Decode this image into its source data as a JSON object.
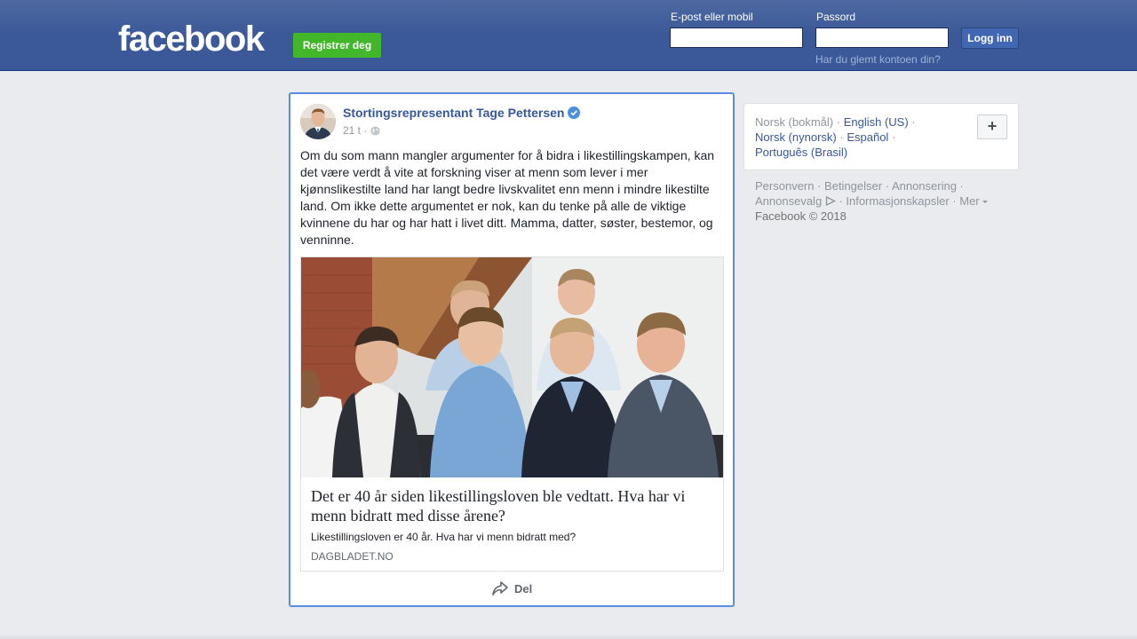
{
  "header": {
    "logo_text": "facebook",
    "register_label": "Registrer deg",
    "email_label": "E-post eller mobil",
    "email_value": "",
    "password_label": "Passord",
    "password_value": "",
    "login_label": "Logg inn",
    "forgot_link": "Har du glemt kontoen din?"
  },
  "post": {
    "author": "Stortingsrepresentant Tage Pettersen",
    "time": "21 t ·",
    "text": "Om du som mann mangler argumenter for å bidra i likestillingskampen, kan det være verdt å vite at forskning viser at menn som lever i mer kjønnslikestilte land har langt bedre livskvalitet enn menn i mindre likestilte land. Om ikke dette argumentet er nok, kan du tenke på alle de viktige kvinnene du har og har hatt i livet ditt. Mamma, datter, søster, bestemor, og venninne.",
    "link": {
      "title": "Det er 40 år siden likestillingsloven ble vedtatt. Hva har vi menn bidratt med disse årene?",
      "description": "Likestillingsloven er 40 år. Hva har vi menn bidratt med?",
      "domain": "DAGBLADET.NO"
    },
    "share_label": "Del"
  },
  "languages": {
    "current": "Norsk (bokmål)",
    "options": [
      "English (US)",
      "Norsk (nynorsk)",
      "Español",
      "Português (Brasil)"
    ],
    "add_label": "+"
  },
  "footer": {
    "links": [
      "Personvern",
      "Betingelser",
      "Annonsering",
      "Annonsevalg",
      "Informasjonskapsler",
      "Mer"
    ],
    "copyright": "Facebook © 2018"
  },
  "colors": {
    "header_blue": "#3b5998",
    "link_blue": "#365899",
    "register_green": "#42b72a",
    "focus_border": "#5b8ce5"
  }
}
